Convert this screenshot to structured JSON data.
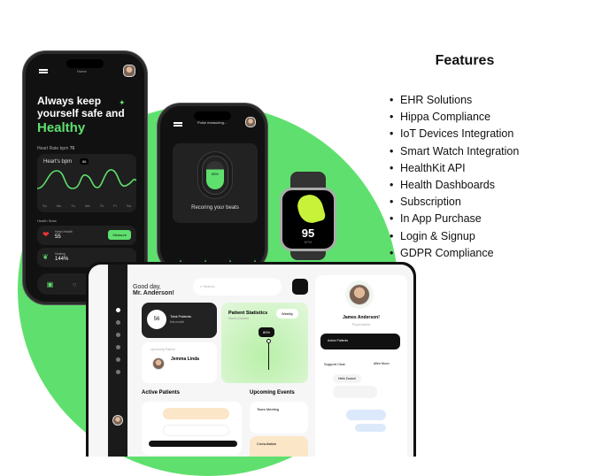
{
  "features": {
    "title": "Features",
    "items": [
      "EHR Solutions",
      "Hippa Compliance",
      "IoT Devices Integration",
      "Smart Watch Integration",
      "HealthKit API",
      "Health Dashboards",
      "Subscription",
      "In App Purchase",
      "Login & Signup",
      "GDPR Compliance"
    ]
  },
  "phone1": {
    "header": "Home",
    "headline1": "Always keep",
    "headline2": "yourself safe and",
    "headline3": "Healthy",
    "section1": "Heart Rate bpm",
    "section1_value": "76",
    "chart_title": "Heart's bpm",
    "chart_badge": "86",
    "days": [
      "Su",
      "Mo",
      "Tu",
      "We",
      "Th",
      "Fr",
      "Sa"
    ],
    "section2": "Health Stats",
    "stat1_label": "Heart Health",
    "stat1_value": "55",
    "stat1_button": "Measure",
    "stat2_label": "Healing",
    "stat2_value": "144%"
  },
  "phone2": {
    "header": "Pulse measuring...",
    "percent": "65%",
    "caption": "Recoring your beats"
  },
  "watch": {
    "value": "95",
    "unit": "BPM"
  },
  "dashboard": {
    "greeting1": "Good day,",
    "greeting2": "Mr. Anderson!",
    "search_placeholder": "Search...",
    "total_value": "56",
    "total_label": "Total Patients",
    "total_sub": "this month",
    "upcoming_label": "Upcoming Patient",
    "patient_name": "Jemma Linda",
    "stats_title": "Patient Statistics",
    "stats_sub": "March-October",
    "stats_dropdown": "Weekly",
    "stats_tooltip": "80%",
    "active_title": "Active Patients",
    "events_title": "Upcoming Events",
    "event1": "Team Meeting",
    "event2": "Consultation",
    "profile_name": "James Anderson!",
    "profile_role": "Psychiatrist",
    "active_patients_label": "Active Patients",
    "support_chat": "Support Chat",
    "chat_user": "Allen Moon",
    "chat_msg1": "Hello Doctor!"
  },
  "colors": {
    "accent": "#5fe06e",
    "dark": "#111111"
  }
}
